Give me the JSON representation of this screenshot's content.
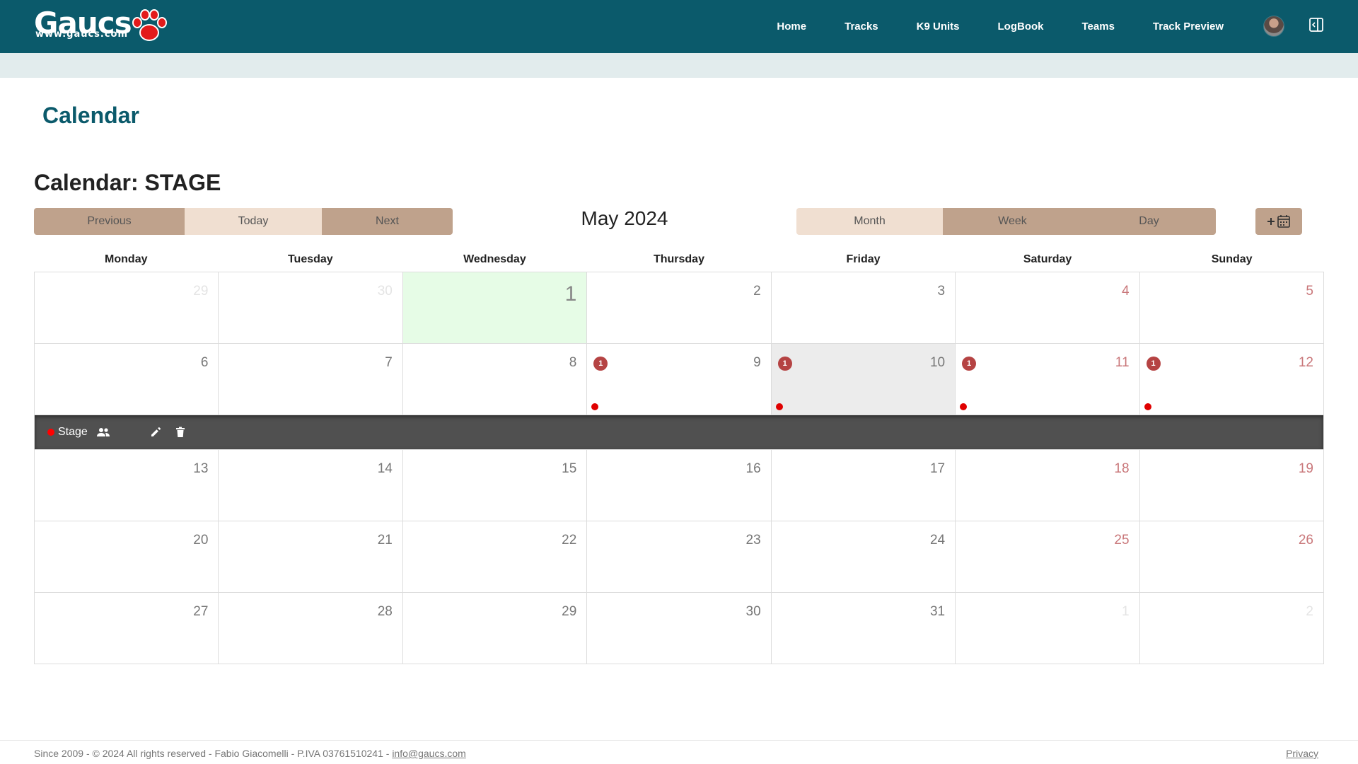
{
  "header": {
    "logo_text": "Gaucs",
    "logo_url": "www.gaucs.com",
    "nav": [
      "Home",
      "Tracks",
      "K9 Units",
      "LogBook",
      "Teams",
      "Track Preview"
    ],
    "brand_color": "#0b5a6b"
  },
  "page": {
    "title": "Calendar",
    "calendar_title": "Calendar: STAGE"
  },
  "toolbar": {
    "previous": "Previous",
    "today": "Today",
    "next": "Next",
    "current_month": "May 2024",
    "month": "Month",
    "week": "Week",
    "day": "Day",
    "add_icon": "plus-calendar-icon"
  },
  "weekdays": [
    "Monday",
    "Tuesday",
    "Wednesday",
    "Thursday",
    "Friday",
    "Saturday",
    "Sunday"
  ],
  "weeks": [
    [
      {
        "n": "29",
        "other": true
      },
      {
        "n": "30",
        "other": true
      },
      {
        "n": "1",
        "today": true
      },
      {
        "n": "2"
      },
      {
        "n": "3"
      },
      {
        "n": "4",
        "weekend": true
      },
      {
        "n": "5",
        "weekend": true
      }
    ],
    [
      {
        "n": "6"
      },
      {
        "n": "7"
      },
      {
        "n": "8"
      },
      {
        "n": "9",
        "badge": "1",
        "dot": true
      },
      {
        "n": "10",
        "badge": "1",
        "dot": true,
        "selected": true
      },
      {
        "n": "11",
        "badge": "1",
        "dot": true,
        "weekend": true
      },
      {
        "n": "12",
        "badge": "1",
        "dot": true,
        "weekend": true
      }
    ],
    [
      {
        "n": "13"
      },
      {
        "n": "14"
      },
      {
        "n": "15"
      },
      {
        "n": "16"
      },
      {
        "n": "17"
      },
      {
        "n": "18",
        "weekend": true
      },
      {
        "n": "19",
        "weekend": true
      }
    ],
    [
      {
        "n": "20"
      },
      {
        "n": "21"
      },
      {
        "n": "22"
      },
      {
        "n": "23"
      },
      {
        "n": "24"
      },
      {
        "n": "25",
        "weekend": true
      },
      {
        "n": "26",
        "weekend": true
      }
    ],
    [
      {
        "n": "27"
      },
      {
        "n": "28"
      },
      {
        "n": "29"
      },
      {
        "n": "30"
      },
      {
        "n": "31"
      },
      {
        "n": "1",
        "other": true
      },
      {
        "n": "2",
        "other": true
      }
    ]
  ],
  "event_detail": {
    "name": "Stage",
    "dot_color": "#ff0000",
    "icons": [
      "users-icon",
      "edit-icon",
      "trash-icon"
    ]
  },
  "footer": {
    "text": "Since 2009 - © 2024 All rights reserved - Fabio Giacomelli - P.IVA 03761510241 - ",
    "email": "info@gaucs.com",
    "privacy": "Privacy"
  }
}
